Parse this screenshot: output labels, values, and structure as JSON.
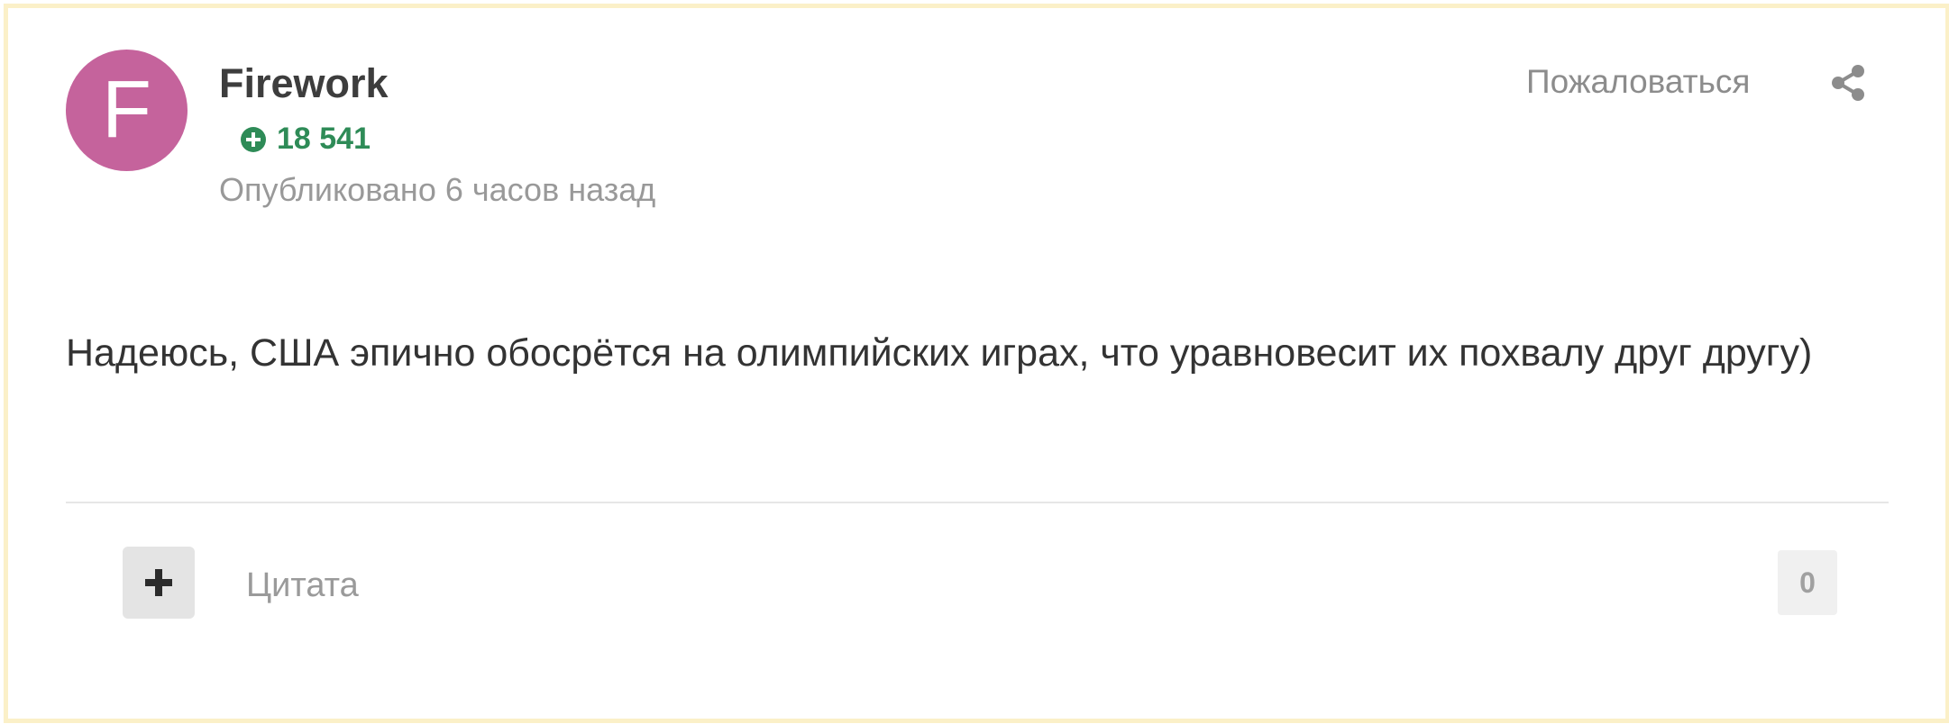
{
  "author": {
    "avatar_letter": "F",
    "avatar_color": "#c5639c",
    "name": "Firework",
    "reputation": "18 541",
    "reputation_icon": "plus-circle-icon",
    "reputation_color": "#2e8b57"
  },
  "meta": {
    "posted": "Опубликовано 6 часов назад"
  },
  "actions": {
    "report_label": "Пожаловаться",
    "share_icon": "share-icon"
  },
  "content": {
    "body": "Надеюсь, США эпично обосрётся на олимпийских играх, что уравновесит их похвалу друг другу)"
  },
  "footer": {
    "plus_icon": "plus-icon",
    "quote_label": "Цитата",
    "reaction_count": "0"
  }
}
